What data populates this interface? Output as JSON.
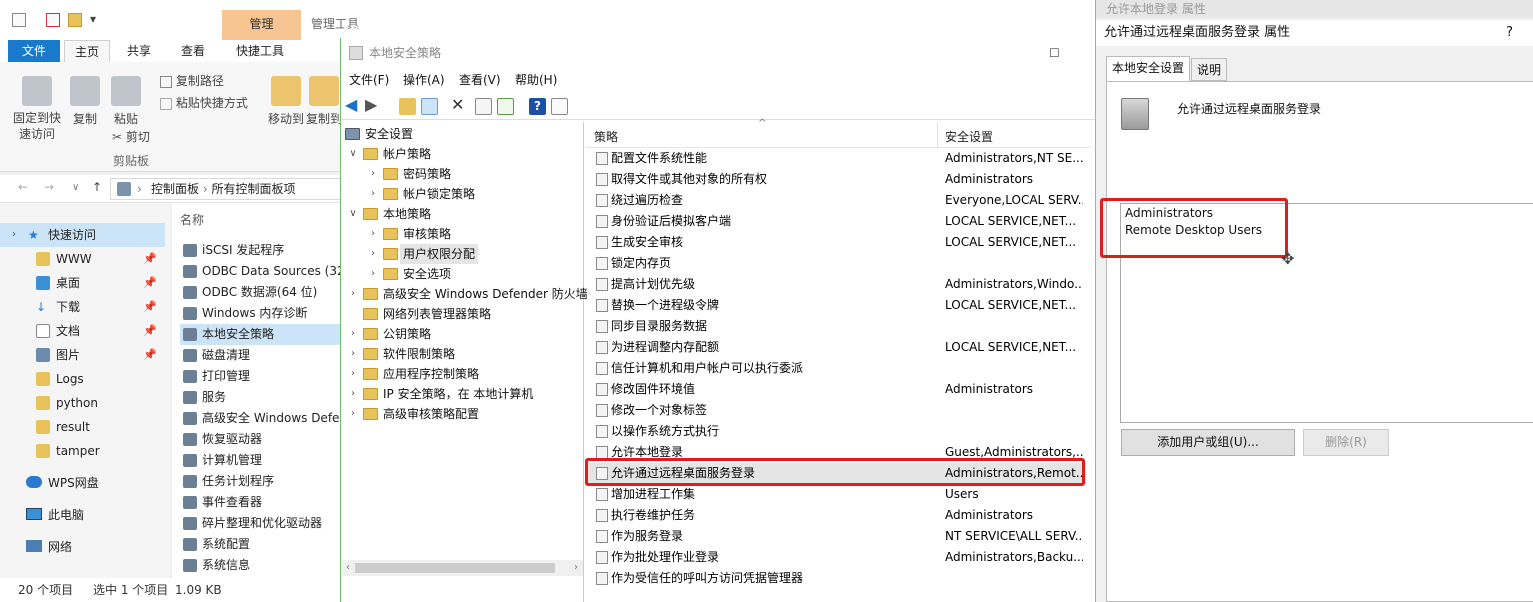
{
  "explorer": {
    "ribbon_context_tab": "管理",
    "ribbon_context_tab2": "管理工具",
    "tabs": [
      "文件",
      "主页",
      "共享",
      "查看",
      "快捷工具"
    ],
    "ribbon": {
      "pin_quick": "固定到快\n速访问",
      "copy": "复制",
      "paste": "粘贴",
      "copy_path": "复制路径",
      "paste_shortcut": "粘贴快捷方式",
      "cut": "剪切",
      "group_clipboard": "剪贴板",
      "move_to": "移动到",
      "copy_to": "复制到"
    },
    "address": {
      "crumbs": [
        "控制面板",
        "所有控制面板项"
      ]
    },
    "nav": {
      "quick_access": "快速访问",
      "items": [
        "WWW",
        "桌面",
        "下载",
        "文档",
        "图片",
        "Logs",
        "python",
        "result",
        "tamper"
      ],
      "wps": "WPS网盘",
      "this_pc": "此电脑",
      "network": "网络"
    },
    "files": {
      "header_name": "名称",
      "items": [
        "iSCSI 发起程序",
        "ODBC Data Sources (32",
        "ODBC 数据源(64 位)",
        "Windows 内存诊断",
        "本地安全策略",
        "磁盘清理",
        "打印管理",
        "服务",
        "高级安全 Windows Defe",
        "恢复驱动器",
        "计算机管理",
        "任务计划程序",
        "事件查看器",
        "碎片整理和优化驱动器",
        "系统配置",
        "系统信息"
      ]
    },
    "status": {
      "count": "20 个项目",
      "selected": "选中 1 个项目",
      "size": "1.09 KB"
    }
  },
  "dimension_label": "1246 x 559",
  "mmc": {
    "title": "本地安全策略",
    "menu": [
      "文件(F)",
      "操作(A)",
      "查看(V)",
      "帮助(H)"
    ],
    "tree": [
      {
        "label": "安全设置",
        "level": 0,
        "exp": ""
      },
      {
        "label": "帐户策略",
        "level": 1,
        "exp": "open"
      },
      {
        "label": "密码策略",
        "level": 2,
        "exp": "closed"
      },
      {
        "label": "帐户锁定策略",
        "level": 2,
        "exp": "closed"
      },
      {
        "label": "本地策略",
        "level": 1,
        "exp": "open"
      },
      {
        "label": "审核策略",
        "level": 2,
        "exp": "closed"
      },
      {
        "label": "用户权限分配",
        "level": 2,
        "exp": "closed",
        "selected": true
      },
      {
        "label": "安全选项",
        "level": 2,
        "exp": "closed"
      },
      {
        "label": "高级安全 Windows Defender 防火墙",
        "level": 1,
        "exp": "closed"
      },
      {
        "label": "网络列表管理器策略",
        "level": 1,
        "exp": ""
      },
      {
        "label": "公钥策略",
        "level": 1,
        "exp": "closed"
      },
      {
        "label": "软件限制策略",
        "level": 1,
        "exp": "closed"
      },
      {
        "label": "应用程序控制策略",
        "level": 1,
        "exp": "closed"
      },
      {
        "label": "IP 安全策略，在 本地计算机",
        "level": 1,
        "exp": "closed"
      },
      {
        "label": "高级审核策略配置",
        "level": 1,
        "exp": "closed"
      }
    ],
    "list_header": {
      "policy": "策略",
      "setting": "安全设置"
    },
    "rows": [
      {
        "name": "配置文件系统性能",
        "setting": "Administrators,NT SE..."
      },
      {
        "name": "取得文件或其他对象的所有权",
        "setting": "Administrators"
      },
      {
        "name": "绕过遍历检查",
        "setting": "Everyone,LOCAL SERV..."
      },
      {
        "name": "身份验证后模拟客户端",
        "setting": "LOCAL SERVICE,NET..."
      },
      {
        "name": "生成安全审核",
        "setting": "LOCAL SERVICE,NET..."
      },
      {
        "name": "锁定内存页",
        "setting": ""
      },
      {
        "name": "提高计划优先级",
        "setting": "Administrators,Windo..."
      },
      {
        "name": "替换一个进程级令牌",
        "setting": "LOCAL SERVICE,NET..."
      },
      {
        "name": "同步目录服务数据",
        "setting": ""
      },
      {
        "name": "为进程调整内存配额",
        "setting": "LOCAL SERVICE,NET..."
      },
      {
        "name": "信任计算机和用户帐户可以执行委派",
        "setting": ""
      },
      {
        "name": "修改固件环境值",
        "setting": "Administrators"
      },
      {
        "name": "修改一个对象标签",
        "setting": ""
      },
      {
        "name": "以操作系统方式执行",
        "setting": ""
      },
      {
        "name": "允许本地登录",
        "setting": "Guest,Administrators,..."
      },
      {
        "name": "允许通过远程桌面服务登录",
        "setting": "Administrators,Remot...",
        "selected": true
      },
      {
        "name": "增加进程工作集",
        "setting": "Users"
      },
      {
        "name": "执行卷维护任务",
        "setting": "Administrators"
      },
      {
        "name": "作为服务登录",
        "setting": "NT SERVICE\\ALL SERV..."
      },
      {
        "name": "作为批处理作业登录",
        "setting": "Administrators,Backu..."
      },
      {
        "name": "作为受信任的呼叫方访问凭据管理器",
        "setting": ""
      }
    ]
  },
  "dialog": {
    "behind_title": "允许本地登录 属性",
    "title": "允许通过远程桌面服务登录 属性",
    "help": "?",
    "tabs": [
      "本地安全设置",
      "说明"
    ],
    "policy_name": "允许通过远程桌面服务登录",
    "users": [
      "Administrators",
      "Remote Desktop Users"
    ],
    "add_button": "添加用户或组(U)...",
    "remove_button": "删除(R)"
  }
}
